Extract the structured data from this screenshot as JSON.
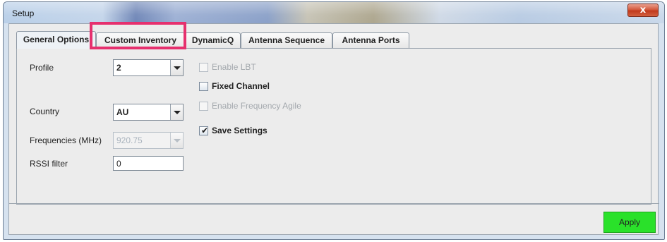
{
  "window": {
    "title": "Setup",
    "close_glyph": "x"
  },
  "tabs": [
    {
      "label": "General Options",
      "active": true
    },
    {
      "label": "Custom Inventory",
      "active": false,
      "highlighted": true
    },
    {
      "label": "DynamicQ",
      "active": false
    },
    {
      "label": "Antenna Sequence",
      "active": false
    },
    {
      "label": "Antenna Ports",
      "active": false
    }
  ],
  "form": {
    "profile": {
      "label": "Profile",
      "value": "2"
    },
    "country": {
      "label": "Country",
      "value": "AU"
    },
    "frequencies": {
      "label": "Frequencies (MHz)",
      "value": "920.75",
      "disabled": true
    },
    "rssi": {
      "label": "RSSI filter",
      "value": "0"
    }
  },
  "checkboxes": {
    "enable_lbt": {
      "label": "Enable LBT",
      "checked": false,
      "disabled": true
    },
    "fixed_channel": {
      "label": "Fixed Channel",
      "checked": false,
      "disabled": false
    },
    "frequency_agile": {
      "label": "Enable Frequency Agile",
      "checked": false,
      "disabled": true
    },
    "save_settings": {
      "label": "Save Settings",
      "checked": true,
      "disabled": false,
      "check_glyph": "✔"
    }
  },
  "actions": {
    "apply_label": "Apply"
  },
  "colors": {
    "highlight": "#e6306e",
    "apply_bg": "#2ae12a",
    "close_bg": "#c0391c"
  }
}
